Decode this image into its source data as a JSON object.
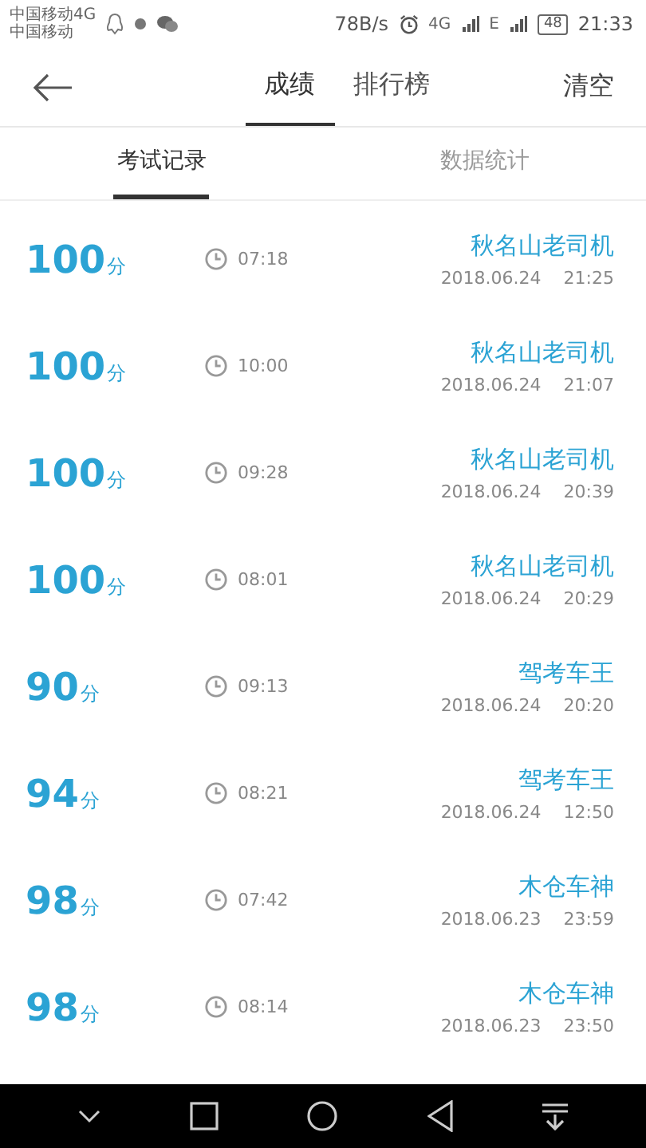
{
  "status_bar": {
    "carriers": [
      "中国移动4G",
      "中国移动"
    ],
    "speed": "78B/s",
    "network_4g": "4G",
    "network_e": "E",
    "battery": "48",
    "time": "21:33"
  },
  "header": {
    "tabs": [
      {
        "label": "成绩",
        "selected": true
      },
      {
        "label": "排行榜",
        "selected": false
      }
    ],
    "action": "清空"
  },
  "subtabs": [
    {
      "label": "考试记录",
      "selected": true
    },
    {
      "label": "数据统计",
      "selected": false
    }
  ],
  "records": [
    {
      "score": "100",
      "unit": "分",
      "duration": "07:18",
      "name": "秋名山老司机",
      "date": "2018.06.24",
      "time": "21:25"
    },
    {
      "score": "100",
      "unit": "分",
      "duration": "10:00",
      "name": "秋名山老司机",
      "date": "2018.06.24",
      "time": "21:07"
    },
    {
      "score": "100",
      "unit": "分",
      "duration": "09:28",
      "name": "秋名山老司机",
      "date": "2018.06.24",
      "time": "20:39"
    },
    {
      "score": "100",
      "unit": "分",
      "duration": "08:01",
      "name": "秋名山老司机",
      "date": "2018.06.24",
      "time": "20:29"
    },
    {
      "score": "90",
      "unit": "分",
      "duration": "09:13",
      "name": "驾考车王",
      "date": "2018.06.24",
      "time": "20:20"
    },
    {
      "score": "94",
      "unit": "分",
      "duration": "08:21",
      "name": "驾考车王",
      "date": "2018.06.24",
      "time": "12:50"
    },
    {
      "score": "98",
      "unit": "分",
      "duration": "07:42",
      "name": "木仓车神",
      "date": "2018.06.23",
      "time": "23:59"
    },
    {
      "score": "98",
      "unit": "分",
      "duration": "08:14",
      "name": "木仓车神",
      "date": "2018.06.23",
      "time": "23:50"
    }
  ]
}
